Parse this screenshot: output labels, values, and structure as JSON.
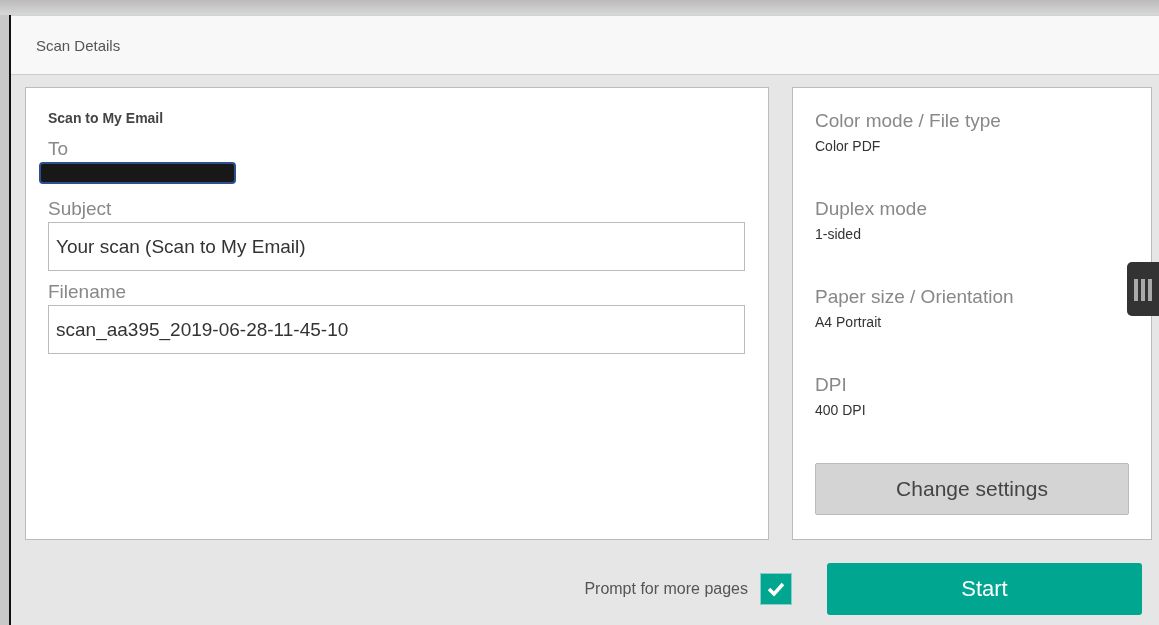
{
  "header": {
    "title": "Scan Details"
  },
  "form": {
    "title": "Scan to My Email",
    "to": {
      "label": "To",
      "redacted": true
    },
    "subject": {
      "label": "Subject",
      "value": "Your scan (Scan to My Email)"
    },
    "filename": {
      "label": "Filename",
      "value": "scan_aa395_2019-06-28-11-45-10"
    }
  },
  "settings": [
    {
      "label": "Color mode / File type",
      "value": "Color PDF"
    },
    {
      "label": "Duplex mode",
      "value": "1-sided"
    },
    {
      "label": "Paper size / Orientation",
      "value": "A4 Portrait"
    },
    {
      "label": "DPI",
      "value": "400 DPI"
    }
  ],
  "change_button": "Change settings",
  "prompt": {
    "label": "Prompt for more pages",
    "checked": true
  },
  "start_button": "Start"
}
